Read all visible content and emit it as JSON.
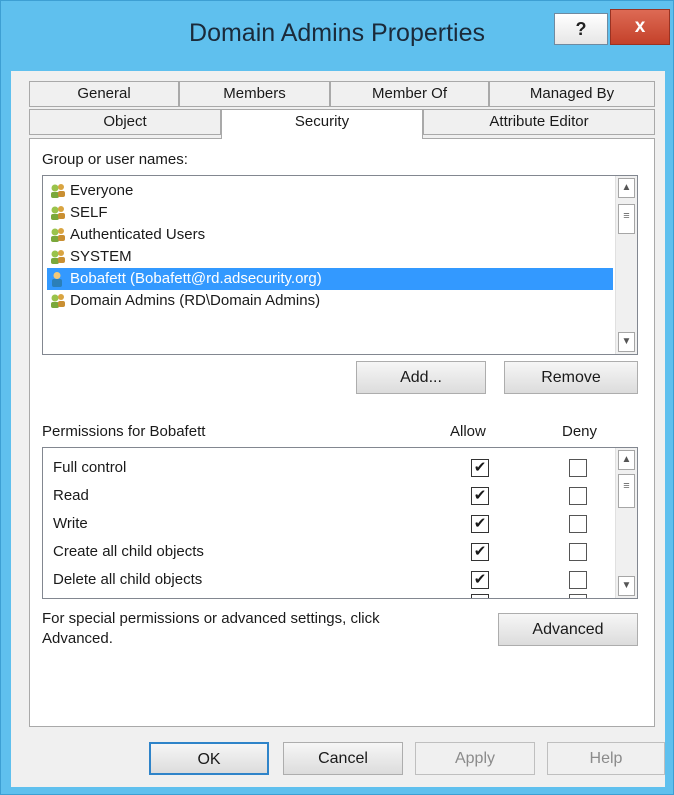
{
  "window": {
    "title": "Domain Admins Properties",
    "help_glyph": "?",
    "close_glyph": "x"
  },
  "tabs": {
    "row1": [
      "General",
      "Members",
      "Member Of",
      "Managed By"
    ],
    "row2": [
      "Object",
      "Security",
      "Attribute Editor"
    ],
    "active": "Security"
  },
  "security": {
    "group_label": "Group or user names:",
    "users": [
      {
        "name": "Everyone",
        "icon": "group-icon"
      },
      {
        "name": "SELF",
        "icon": "group-icon"
      },
      {
        "name": "Authenticated Users",
        "icon": "group-icon"
      },
      {
        "name": "SYSTEM",
        "icon": "group-icon"
      },
      {
        "name": "Bobafett (Bobafett@rd.adsecurity.org)",
        "icon": "user-icon",
        "selected": true
      },
      {
        "name": "Domain Admins (RD\\Domain Admins)",
        "icon": "group-icon"
      }
    ],
    "add_label": "Add...",
    "remove_label": "Remove",
    "permissions_label": "Permissions for Bobafett",
    "allow_label": "Allow",
    "deny_label": "Deny",
    "permissions": [
      {
        "name": "Full control",
        "allow": true,
        "deny": false
      },
      {
        "name": "Read",
        "allow": true,
        "deny": false
      },
      {
        "name": "Write",
        "allow": true,
        "deny": false
      },
      {
        "name": "Create all child objects",
        "allow": true,
        "deny": false
      },
      {
        "name": "Delete all child objects",
        "allow": true,
        "deny": false
      }
    ],
    "advanced_text": "For special permissions or advanced settings, click Advanced.",
    "advanced_label": "Advanced"
  },
  "footer": {
    "ok": "OK",
    "cancel": "Cancel",
    "apply": "Apply",
    "help": "Help"
  },
  "colors": {
    "titlebar": "#5fc0ee",
    "selection": "#3399ff",
    "close": "#c4412a"
  }
}
